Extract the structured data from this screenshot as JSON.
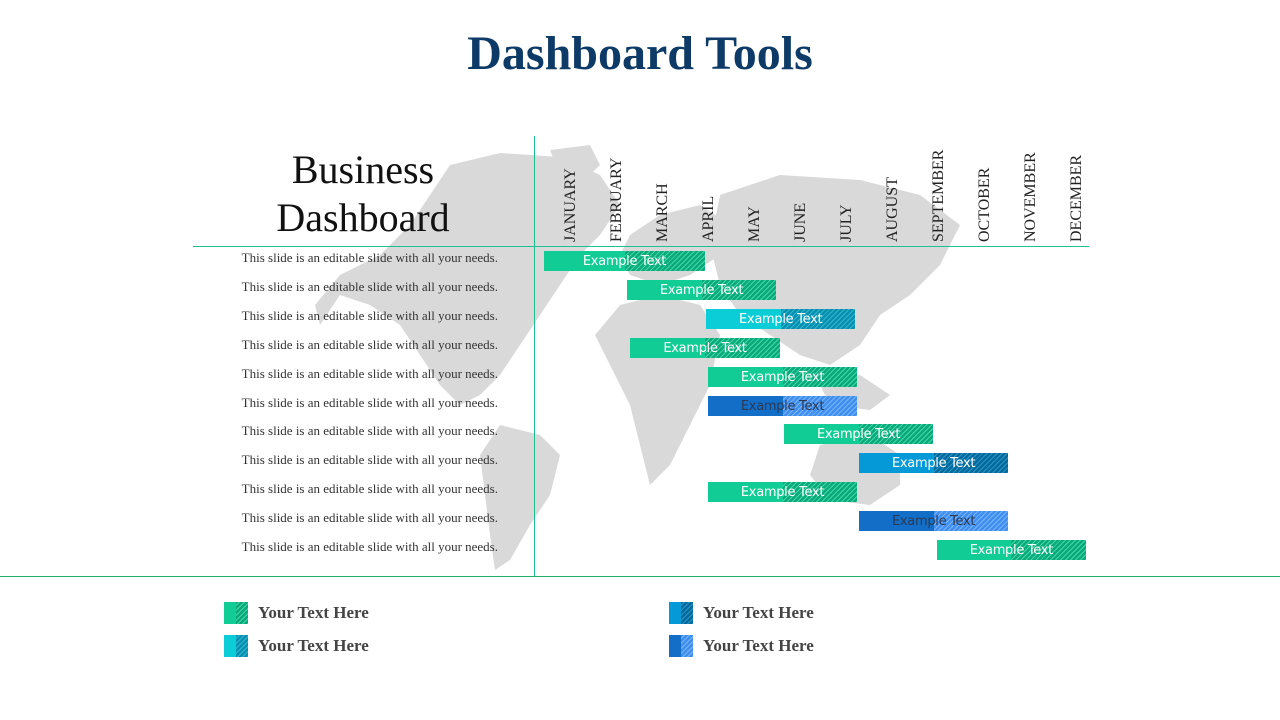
{
  "page": {
    "title": "Dashboard Tools",
    "subtitle_line1": "Business",
    "subtitle_line2": "Dashboard"
  },
  "colors": {
    "title": "#0d3a66",
    "divider": "#1fbf8f",
    "map": "#d9d9d9",
    "green": {
      "solid": "#12cc95",
      "hatch_bg": "#0da879",
      "hatch_line": "#3fd9a9",
      "text": "#ffffff"
    },
    "cyan": {
      "solid": "#0bcdd8",
      "hatch_bg": "#0b8fb0",
      "hatch_line": "#2bb7cf",
      "text": "#ffffff"
    },
    "lightblue": {
      "solid": "#0599d8",
      "hatch_bg": "#046a9e",
      "hatch_line": "#2a95c4",
      "text": "#ffffff"
    },
    "blue": {
      "solid": "#126ec7",
      "hatch_bg": "#3f8ff0",
      "hatch_line": "#7ab4f7",
      "text": "#2b3a55"
    }
  },
  "chart_data": {
    "type": "gantt",
    "title": "Business Dashboard",
    "months": [
      "JANUARY",
      "FEBRUARY",
      "MARCH",
      "APRIL",
      "MAY",
      "JUNE",
      "JULY",
      "AUGUST",
      "SEPTEMBER",
      "OCTOBER",
      "NOVEMBER",
      "DECEMBER"
    ],
    "tasks": [
      {
        "row_label": "This slide is an editable slide with all your needs.",
        "bar_label": "Example Text",
        "start": 0.0,
        "end": 3.5,
        "color": "green"
      },
      {
        "row_label": "This slide is an editable slide with all your needs.",
        "bar_label": "Example Text",
        "start": 1.8,
        "end": 5.05,
        "color": "green"
      },
      {
        "row_label": "This slide is an editable slide with all your needs.",
        "bar_label": "Example Text",
        "start": 3.52,
        "end": 6.77,
        "color": "cyan"
      },
      {
        "row_label": "This slide is an editable slide with all your needs.",
        "bar_label": "Example Text",
        "start": 1.87,
        "end": 5.13,
        "color": "green"
      },
      {
        "row_label": "This slide is an editable slide with all your needs.",
        "bar_label": "Example Text",
        "start": 3.57,
        "end": 6.8,
        "color": "green"
      },
      {
        "row_label": "This slide is an editable slide with all your needs.",
        "bar_label": "Example Text",
        "start": 3.57,
        "end": 6.8,
        "color": "blue"
      },
      {
        "row_label": "This slide is an editable slide with all your needs.",
        "bar_label": "Example Text",
        "start": 5.22,
        "end": 8.46,
        "color": "green"
      },
      {
        "row_label": "This slide is an editable slide with all your needs.",
        "bar_label": "Example Text",
        "start": 6.85,
        "end": 10.09,
        "color": "lightblue"
      },
      {
        "row_label": "This slide is an editable slide with all your needs.",
        "bar_label": "Example Text",
        "start": 3.57,
        "end": 6.8,
        "color": "green"
      },
      {
        "row_label": "This slide is an editable slide with all your needs.",
        "bar_label": "Example Text",
        "start": 6.85,
        "end": 10.09,
        "color": "blue"
      },
      {
        "row_label": "This slide is an editable slide with all your needs.",
        "bar_label": "Example Text",
        "start": 8.54,
        "end": 11.78,
        "color": "green"
      }
    ],
    "legend": [
      {
        "label": "Your Text Here",
        "color": "green"
      },
      {
        "label": "Your Text Here",
        "color": "cyan"
      },
      {
        "label": "Your Text Here",
        "color": "lightblue"
      },
      {
        "label": "Your Text Here",
        "color": "blue"
      }
    ]
  }
}
